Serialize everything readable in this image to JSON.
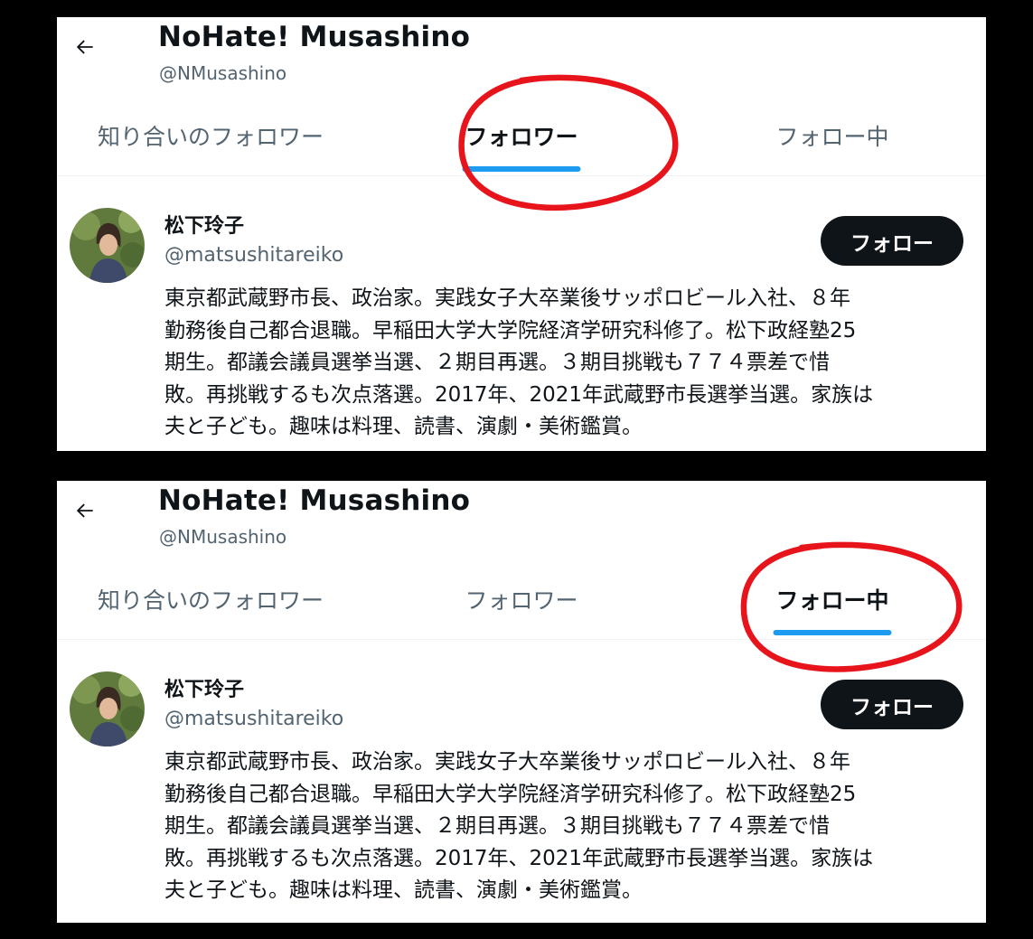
{
  "screens": [
    {
      "header": {
        "title": "NoHate! Musashino",
        "handle": "@NMusashino"
      },
      "tabs": [
        {
          "label": "知り合いのフォロワー",
          "active": false
        },
        {
          "label": "フォロワー",
          "active": true
        },
        {
          "label": "フォロー中",
          "active": false
        }
      ],
      "highlighted_tab": "フォロワー",
      "user": {
        "name": "松下玲子",
        "handle": "@matsushitareiko",
        "follow_label": "フォロー",
        "bio_lines": [
          "東京都武蔵野市長、政治家。実践女子大卒業後サッポロビール入社、８年",
          "勤務後自己都合退職。早稲田大学大学院経済学研究科修了。松下政経塾25",
          "期生。都議会議員選挙当選、２期目再選。３期目挑戦も７７４票差で惜",
          "敗。再挑戦するも次点落選。2017年、2021年武蔵野市長選挙当選。家族は",
          "夫と子ども。趣味は料理、読書、演劇・美術鑑賞。"
        ]
      }
    },
    {
      "header": {
        "title": "NoHate! Musashino",
        "handle": "@NMusashino"
      },
      "tabs": [
        {
          "label": "知り合いのフォロワー",
          "active": false
        },
        {
          "label": "フォロワー",
          "active": false
        },
        {
          "label": "フォロー中",
          "active": true
        }
      ],
      "highlighted_tab": "フォロー中",
      "user": {
        "name": "松下玲子",
        "handle": "@matsushitareiko",
        "follow_label": "フォロー",
        "bio_lines": [
          "東京都武蔵野市長、政治家。実践女子大卒業後サッポロビール入社、８年",
          "勤務後自己都合退職。早稲田大学大学院経済学研究科修了。松下政経塾25",
          "期生。都議会議員選挙当選、２期目再選。３期目挑戦も７７４票差で惜",
          "敗。再挑戦するも次点落選。2017年、2021年武蔵野市長選挙当選。家族は",
          "夫と子ども。趣味は料理、読書、演劇・美術鑑賞。"
        ]
      }
    }
  ],
  "colors": {
    "accent": "#1d9bf0",
    "annotation": "#e8141c",
    "button_bg": "#0f1419",
    "text_secondary": "#536471"
  },
  "icons": {
    "back": "back-arrow-icon",
    "avatar": "profile-photo"
  }
}
